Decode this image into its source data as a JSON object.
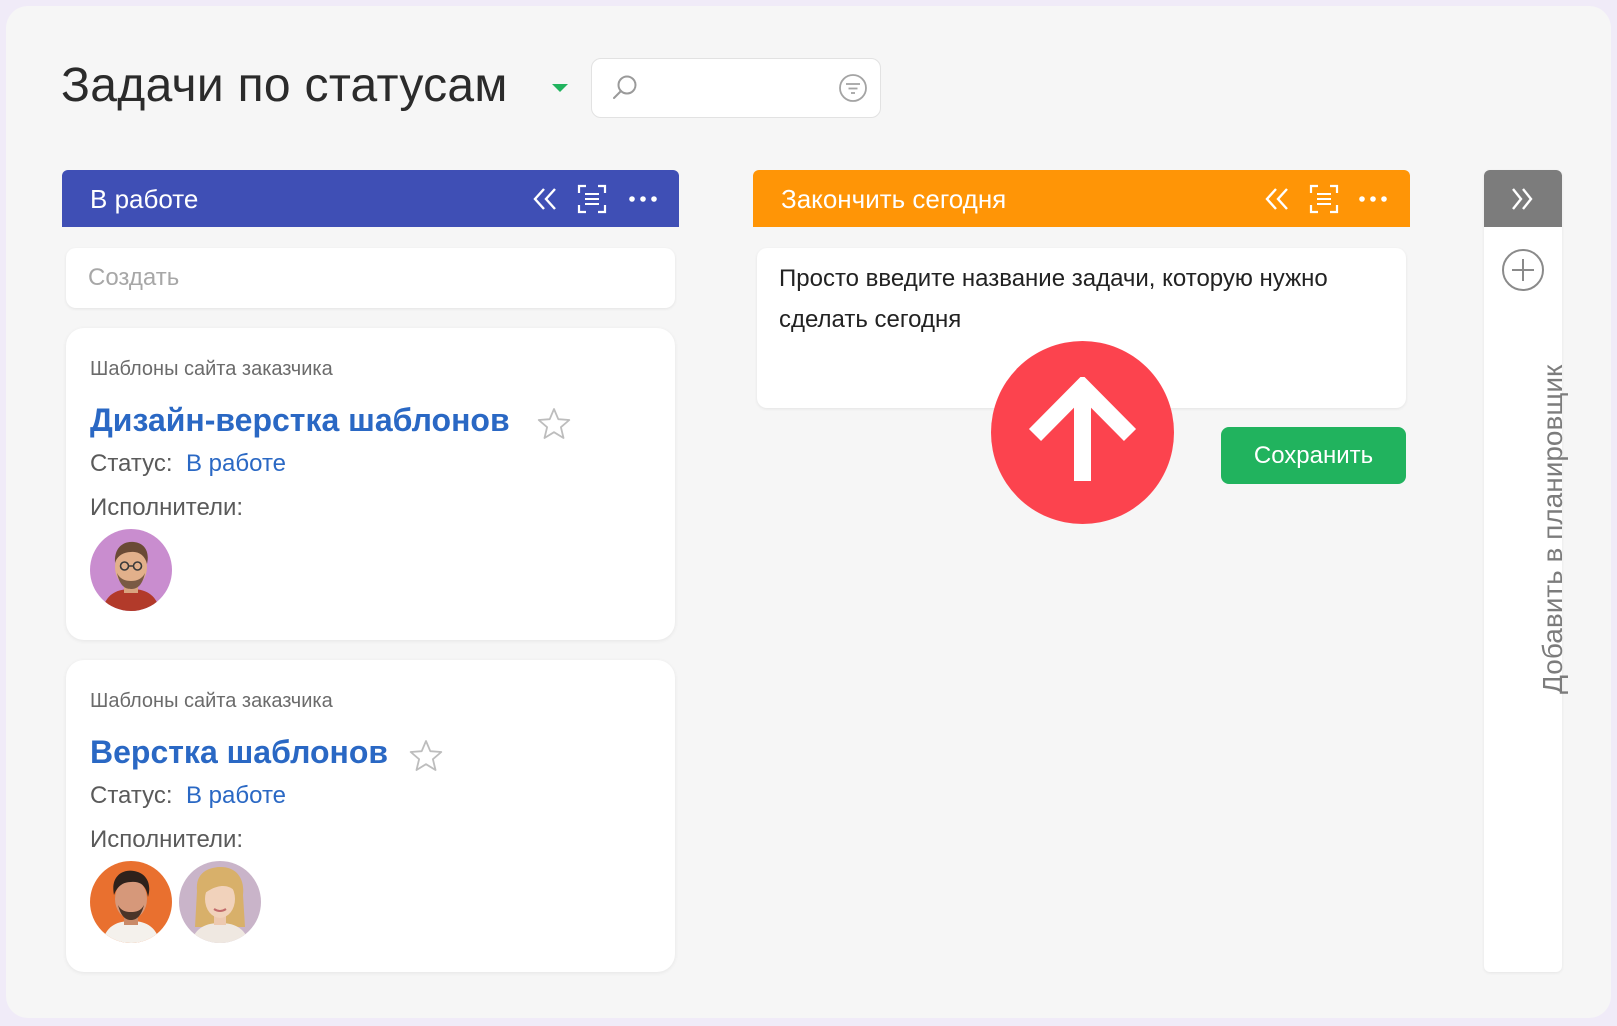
{
  "header": {
    "title": "Задачи по статусам",
    "search": {
      "value": "",
      "placeholder": ""
    }
  },
  "columns": [
    {
      "label": "В работе",
      "color": "#3f4fb5"
    },
    {
      "label": "Закончить сегодня",
      "color": "#ff9506"
    }
  ],
  "create": {
    "placeholder": "Создать"
  },
  "cards": [
    {
      "project": "Шаблоны сайта заказчика",
      "title": "Дизайн-верстка шаблонов",
      "status_label": "Статус:",
      "status_value": "В работе",
      "assignees_label": "Исполнители:"
    },
    {
      "project": "Шаблоны сайта заказчика",
      "title": "Верстка шаблонов",
      "status_label": "Статус:",
      "status_value": "В работе",
      "assignees_label": "Исполнители:"
    }
  ],
  "quick_task": {
    "text": "Просто введите название задачи, которую нужно сделать сегодня",
    "save_label": "Сохранить"
  },
  "planner": {
    "label": "Добавить в планировщик"
  },
  "colors": {
    "accent_green": "#21b35e",
    "link_blue": "#2a68c4",
    "arrow_red": "#fc434e",
    "planner_gray": "#7c7c7c"
  }
}
